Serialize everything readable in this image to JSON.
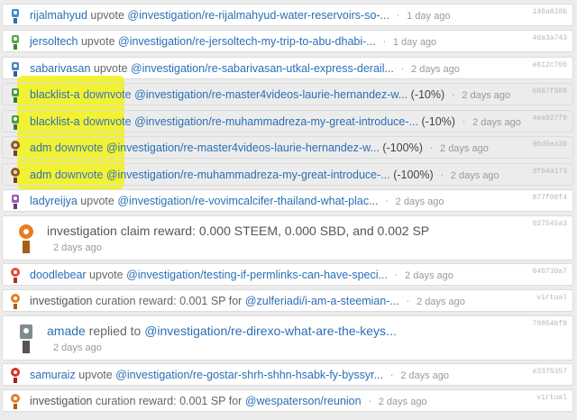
{
  "rows": [
    {
      "user": "rijalmahyud",
      "verb": "upvote",
      "link": "@investigation/re-rijalmahyud-water-reservoirs-so-...",
      "pct": "",
      "time": "1 day ago",
      "hash": "140a828b",
      "icon": "robot-icon-blue"
    },
    {
      "user": "jersoltech",
      "verb": "upvote",
      "link": "@investigation/re-jersoltech-my-trip-to-abu-dhabi-...",
      "pct": "",
      "time": "1 day ago",
      "hash": "4da3a743",
      "icon": "robot-icon-green"
    },
    {
      "user": "sabarivasan",
      "verb": "upvote",
      "link": "@investigation/re-sabarivasan-utkal-express-derail...",
      "pct": "",
      "time": "2 days ago",
      "hash": "e612c70b",
      "icon": "robot-icon-blue"
    },
    {
      "user": "blacklist-a",
      "verb": "downvote",
      "link": "@investigation/re-master4videos-laurie-hernandez-w...",
      "pct": "(-10%)",
      "time": "2 days ago",
      "hash": "6867f888",
      "icon": "robot-icon-green"
    },
    {
      "user": "blacklist-a",
      "verb": "downvote",
      "link": "@investigation/re-muhammadreza-my-great-introduce-...",
      "pct": "(-10%)",
      "time": "2 days ago",
      "hash": "4ea927f0",
      "icon": "robot-icon-green"
    },
    {
      "user": "adm",
      "verb": "downvote",
      "link": "@investigation/re-master4videos-laurie-hernandez-w...",
      "pct": "(-100%)",
      "time": "2 days ago",
      "hash": "9bd5ea30",
      "icon": "robot-icon-brown"
    },
    {
      "user": "adm",
      "verb": "downvote",
      "link": "@investigation/re-muhammadreza-my-great-introduce-...",
      "pct": "(-100%)",
      "time": "2 days ago",
      "hash": "dfb4a173",
      "icon": "robot-icon-brown"
    },
    {
      "user": "ladyreijya",
      "verb": "upvote",
      "link": "@investigation/re-vovimcalcifer-thailand-what-plac...",
      "pct": "",
      "time": "2 days ago",
      "hash": "877f08f4",
      "icon": "robot-icon-purple"
    }
  ],
  "claim": {
    "user": "investigation",
    "text": "claim reward: 0.000 STEEM, 0.000 SBD, and 0.002 SP",
    "time": "2 days ago",
    "hash": "027545a3",
    "icon": "robot-icon-orange"
  },
  "rows2": [
    {
      "user": "doodlebear",
      "verb": "upvote",
      "link": "@investigation/testing-if-permlinks-can-have-speci...",
      "pct": "",
      "time": "2 days ago",
      "hash": "040730a7",
      "icon": "robot-icon-red"
    },
    {
      "user": "investigation",
      "verb": "curation reward: 0.001 SP for",
      "link": "@zulferiadi/i-am-a-steemian-...",
      "pct": "",
      "time": "2 days ago",
      "hash": "virtual",
      "icon": "robot-icon-orange"
    }
  ],
  "reply": {
    "user": "amade",
    "verb": "replied to",
    "link": "@investigation/re-direxo-what-are-the-keys...",
    "time": "2 days ago",
    "hash": "79854bf0",
    "icon": "robot-icon-gray"
  },
  "rows3": [
    {
      "user": "samuraiz",
      "verb": "upvote",
      "link": "@investigation/re-gostar-shrh-shhn-hsabk-fy-byssyr...",
      "pct": "",
      "time": "2 days ago",
      "hash": "e3375357",
      "icon": "robot-icon-red"
    },
    {
      "user": "investigation",
      "verb": "curation reward: 0.001 SP for",
      "link": "@wespaterson/reunion",
      "pct": "",
      "time": "2 days ago",
      "hash": "virtual",
      "icon": "robot-icon-orange"
    }
  ],
  "colors": {
    "highlight": "#f3f31a",
    "link": "#2a6fb6",
    "downvote": "#3a73c0"
  }
}
